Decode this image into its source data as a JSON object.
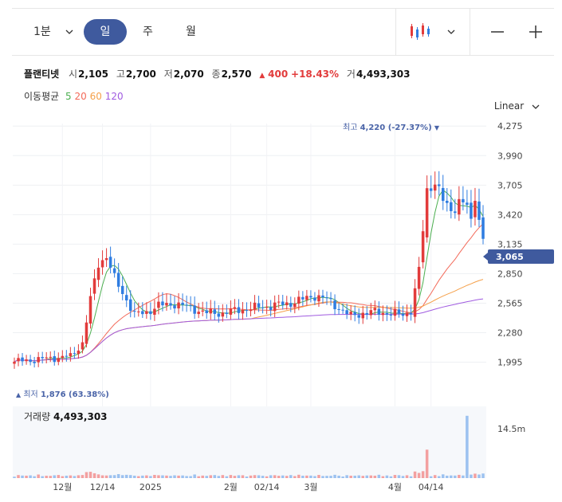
{
  "toolbar": {
    "minute_label": "1분",
    "day_label": "일",
    "week_label": "주",
    "month_label": "월",
    "chart_type_icon": "candlestick-icon",
    "zoom_out_icon": "minus-icon",
    "zoom_in_icon": "plus-icon"
  },
  "stock": {
    "name": "플랜티넷",
    "open_label": "시",
    "open": "2,105",
    "high_label": "고",
    "high": "2,700",
    "low_label": "저",
    "low": "2,070",
    "close_label": "종",
    "close": "2,570",
    "change_arrow": "▲",
    "change": "400",
    "change_pct": "+18.43%",
    "volume_label": "거",
    "volume": "4,493,303"
  },
  "ma": {
    "label": "이동평균",
    "periods": [
      "5",
      "20",
      "60",
      "120"
    ],
    "colors": [
      "#4caf50",
      "#f36a5a",
      "#f5a04a",
      "#a05be0"
    ]
  },
  "scale_label": "Linear",
  "colors": {
    "up": "#e23b3b",
    "down": "#2f7de1",
    "accent": "#3f5a9e"
  },
  "annotations": {
    "max_label": "최고",
    "max_value": "4,220 (-27.37%)",
    "max_marker": "▼",
    "min_marker": "▲",
    "min_label": "최저",
    "min_value": "1,876 (63.38%)",
    "current_price": "3,065"
  },
  "volume_panel": {
    "label": "거래량",
    "value": "4,493,303",
    "tick": "14.5m"
  },
  "chart_data": {
    "type": "candlestick",
    "y_ticks": [
      "4,275",
      "3,990",
      "3,705",
      "3,420",
      "3,135",
      "2,850",
      "2,565",
      "2,280",
      "1,995"
    ],
    "y_values": [
      4275,
      3990,
      3705,
      3420,
      3135,
      2850,
      2565,
      2280,
      1995
    ],
    "ylim": [
      1876,
      4300
    ],
    "x_ticks": [
      "12월",
      "12/14",
      "2025",
      "2월",
      "02/14",
      "3월",
      "4월",
      "04/14"
    ],
    "x_tick_index": [
      12,
      22,
      34,
      54,
      63,
      74,
      95,
      104
    ],
    "n_candles": 118,
    "anchors": [
      [
        0,
        2000
      ],
      [
        3,
        2010
      ],
      [
        8,
        2030
      ],
      [
        14,
        2050
      ],
      [
        17,
        2180
      ],
      [
        19,
        2600
      ],
      [
        21,
        2950
      ],
      [
        23,
        3020
      ],
      [
        25,
        2800
      ],
      [
        28,
        2600
      ],
      [
        30,
        2450
      ],
      [
        33,
        2480
      ],
      [
        36,
        2540
      ],
      [
        40,
        2560
      ],
      [
        44,
        2520
      ],
      [
        48,
        2470
      ],
      [
        52,
        2470
      ],
      [
        56,
        2500
      ],
      [
        60,
        2520
      ],
      [
        64,
        2540
      ],
      [
        68,
        2560
      ],
      [
        72,
        2600
      ],
      [
        75,
        2640
      ],
      [
        78,
        2600
      ],
      [
        81,
        2520
      ],
      [
        84,
        2440
      ],
      [
        87,
        2470
      ],
      [
        90,
        2480
      ],
      [
        94,
        2470
      ],
      [
        97,
        2450
      ],
      [
        99,
        2500
      ],
      [
        101,
        2880
      ],
      [
        103,
        3650
      ],
      [
        105,
        3750
      ],
      [
        107,
        3550
      ],
      [
        109,
        3450
      ],
      [
        111,
        3560
      ],
      [
        113,
        3500
      ],
      [
        114,
        3330
      ],
      [
        115,
        3600
      ],
      [
        116,
        3400
      ],
      [
        117,
        3180
      ]
    ],
    "volume_ylim": [
      0,
      14500000
    ],
    "volume_tick": "14.5m"
  }
}
